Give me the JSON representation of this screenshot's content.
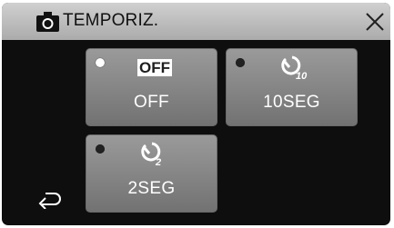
{
  "header": {
    "title": "TEMPORIZ.",
    "camera_icon": "camera-icon",
    "close_icon": "close-icon"
  },
  "options": [
    {
      "label": "OFF",
      "badge": "OFF",
      "selected": true,
      "icon": "off-badge"
    },
    {
      "label": "10SEG",
      "selected": false,
      "icon": "self-timer-10-icon",
      "sub": "10"
    },
    {
      "label": "2SEG",
      "selected": false,
      "icon": "self-timer-2-icon",
      "sub": "2"
    }
  ],
  "footer": {
    "back_icon": "return-icon"
  },
  "colors": {
    "background": "#0e0e0e",
    "header": "#bcbcbc",
    "tile": "#8a8a8a",
    "text": "#ffffff"
  }
}
